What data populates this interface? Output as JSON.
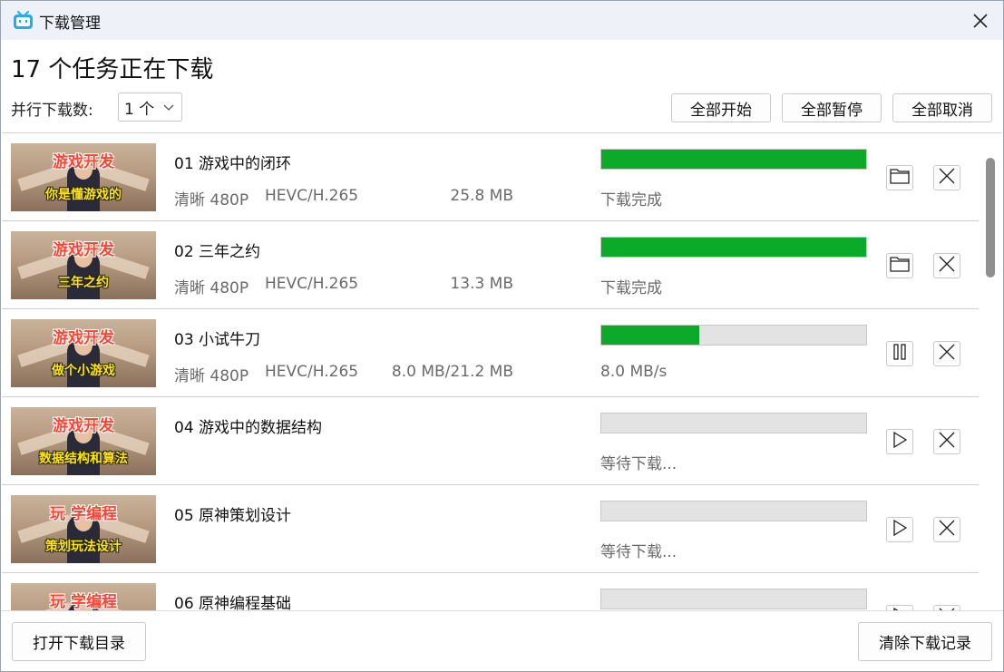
{
  "window": {
    "title": "下载管理",
    "icon": "bilibili-tv-icon",
    "close_icon": "close-icon"
  },
  "header": {
    "headline": "17 个任务正在下载",
    "parallel_label": "并行下载数:",
    "parallel_value": "1 个",
    "buttons": {
      "start_all": "全部开始",
      "pause_all": "全部暂停",
      "cancel_all": "全部取消"
    }
  },
  "accent": {
    "progress": "#0bab29",
    "track": "#e3e3e3"
  },
  "tasks": [
    {
      "title": "01 游戏中的闭环",
      "quality": "清晰 480P",
      "codec": "HEVC/H.265",
      "size": "25.8 MB",
      "progress": 1.0,
      "status": "下载完成",
      "action_icon": "folder-icon",
      "thumb_top": "游戏开发",
      "thumb_bottom": "你是懂游戏的"
    },
    {
      "title": "02 三年之约",
      "quality": "清晰 480P",
      "codec": "HEVC/H.265",
      "size": "13.3 MB",
      "progress": 1.0,
      "status": "下载完成",
      "action_icon": "folder-icon",
      "thumb_top": "游戏开发",
      "thumb_bottom": "三年之约"
    },
    {
      "title": "03 小试牛刀",
      "quality": "清晰 480P",
      "codec": "HEVC/H.265",
      "size": "8.0 MB/21.2 MB",
      "progress": 0.37,
      "status": "8.0 MB/s",
      "action_icon": "pause-icon",
      "thumb_top": "游戏开发",
      "thumb_bottom": "做个小游戏"
    },
    {
      "title": "04 游戏中的数据结构",
      "quality": "",
      "codec": "",
      "size": "",
      "progress": 0,
      "status": "等待下载...",
      "action_icon": "play-icon",
      "thumb_top": "游戏开发",
      "thumb_bottom": "数据结构和算法"
    },
    {
      "title": "05 原神策划设计",
      "quality": "",
      "codec": "",
      "size": "",
      "progress": 0,
      "status": "等待下载...",
      "action_icon": "play-icon",
      "thumb_top": "玩 学编程",
      "thumb_bottom": "策划玩法设计"
    },
    {
      "title": "06 原神编程基础",
      "quality": "",
      "codec": "",
      "size": "",
      "progress": 0,
      "status": "",
      "action_icon": "play-icon",
      "thumb_top": "玩 学编程",
      "thumb_bottom": ""
    }
  ],
  "footer": {
    "open_dir": "打开下载目录",
    "clear_history": "清除下载记录"
  }
}
